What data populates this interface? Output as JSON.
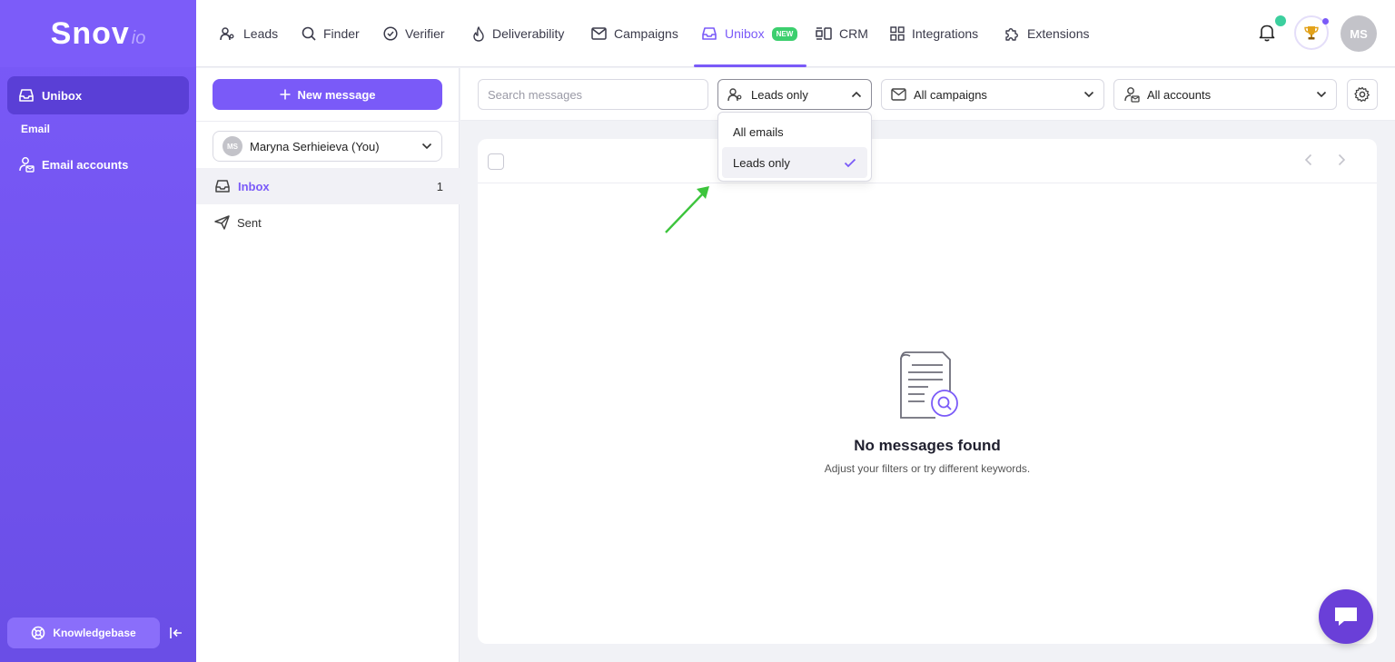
{
  "sidebar": {
    "logo_main": "Snov",
    "logo_sub": "io",
    "active_item": "Unibox",
    "section_label": "Email",
    "accounts_item": "Email accounts",
    "knowledgebase": "Knowledgebase"
  },
  "topnav": {
    "items": [
      {
        "label": "Leads",
        "icon": "leads-icon"
      },
      {
        "label": "Finder",
        "icon": "search-icon"
      },
      {
        "label": "Verifier",
        "icon": "check-circle-icon"
      },
      {
        "label": "Deliverability",
        "icon": "flame-icon"
      },
      {
        "label": "Campaigns",
        "icon": "envelope-icon"
      },
      {
        "label": "Unibox",
        "icon": "inbox-icon",
        "badge": "NEW",
        "active": true
      },
      {
        "label": "CRM",
        "icon": "crm-icon"
      },
      {
        "label": "Integrations",
        "icon": "grid-icon"
      },
      {
        "label": "Extensions",
        "icon": "puzzle-icon"
      }
    ],
    "avatar_initials": "MS"
  },
  "folders": {
    "new_message": "New message",
    "account": {
      "initials": "MS",
      "name": "Maryna Serhieieva (You)"
    },
    "inbox": {
      "label": "Inbox",
      "count": "1"
    },
    "sent": {
      "label": "Sent"
    }
  },
  "toolbar": {
    "search_placeholder": "Search messages",
    "leads_filter": "Leads only",
    "campaigns_filter": "All campaigns",
    "accounts_filter": "All accounts"
  },
  "menu": {
    "options": [
      "All emails",
      "Leads only"
    ],
    "selected": "Leads only"
  },
  "empty": {
    "title": "No messages found",
    "subtitle": "Adjust your filters or try different keywords."
  },
  "colors": {
    "accent": "#7a5af8",
    "badge": "#3ccf6e",
    "arrow": "#3cc43c"
  }
}
